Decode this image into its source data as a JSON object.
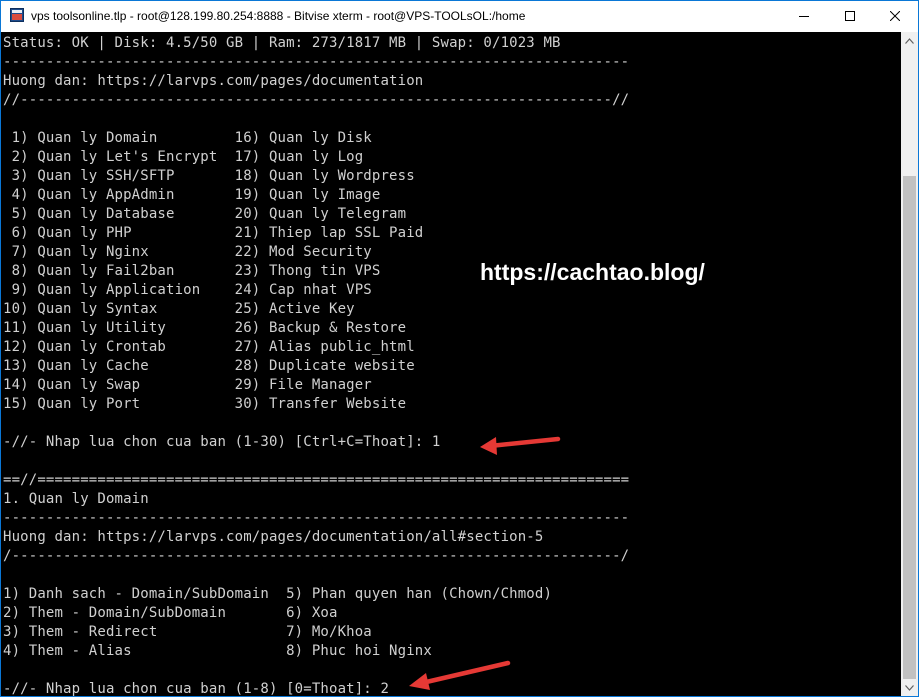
{
  "window": {
    "title": "vps toolsonline.tlp - root@128.199.80.254:8888 - Bitvise xterm - root@VPS-TOOLsOL:/home",
    "colors": {
      "titlebar_bg": "#ffffff",
      "terminal_bg": "#000000",
      "terminal_fg": "#d0d0d0",
      "border": "#0a77d6",
      "arrow": "#e53935"
    },
    "icons": [
      "terminal-app-icon",
      "minimize-icon",
      "maximize-icon",
      "close-icon"
    ]
  },
  "terminal": {
    "lines": [
      "Status: OK | Disk: 4.5/50 GB | Ram: 273/1817 MB | Swap: 0/1023 MB",
      "-------------------------------------------------------------------------",
      "Huong dan: https://larvps.com/pages/documentation",
      "//---------------------------------------------------------------------//",
      "",
      " 1) Quan ly Domain         16) Quan ly Disk",
      " 2) Quan ly Let's Encrypt  17) Quan ly Log",
      " 3) Quan ly SSH/SFTP       18) Quan ly Wordpress",
      " 4) Quan ly AppAdmin       19) Quan ly Image",
      " 5) Quan ly Database       20) Quan ly Telegram",
      " 6) Quan ly PHP            21) Thiep lap SSL Paid",
      " 7) Quan ly Nginx          22) Mod Security",
      " 8) Quan ly Fail2ban       23) Thong tin VPS",
      " 9) Quan ly Application    24) Cap nhat VPS",
      "10) Quan ly Syntax         25) Active Key",
      "11) Quan ly Utility        26) Backup & Restore",
      "12) Quan ly Crontab        27) Alias public_html",
      "13) Quan ly Cache          28) Duplicate website",
      "14) Quan ly Swap           29) File Manager",
      "15) Quan ly Port           30) Transfer Website",
      "",
      "-//- Nhap lua chon cua ban (1-30) [Ctrl+C=Thoat]: 1",
      "",
      "==//=====================================================================",
      "1. Quan ly Domain",
      "-------------------------------------------------------------------------",
      "Huong dan: https://larvps.com/pages/documentation/all#section-5",
      "/-----------------------------------------------------------------------/",
      "",
      "1) Danh sach - Domain/SubDomain  5) Phan quyen han (Chown/Chmod)",
      "2) Them - Domain/SubDomain       6) Xoa",
      "3) Them - Redirect               7) Mo/Khoa",
      "4) Them - Alias                  8) Phuc hoi Nginx",
      "",
      "-//- Nhap lua chon cua ban (1-8) [0=Thoat]: 2"
    ]
  },
  "watermark": "https://cachtao.blog/"
}
